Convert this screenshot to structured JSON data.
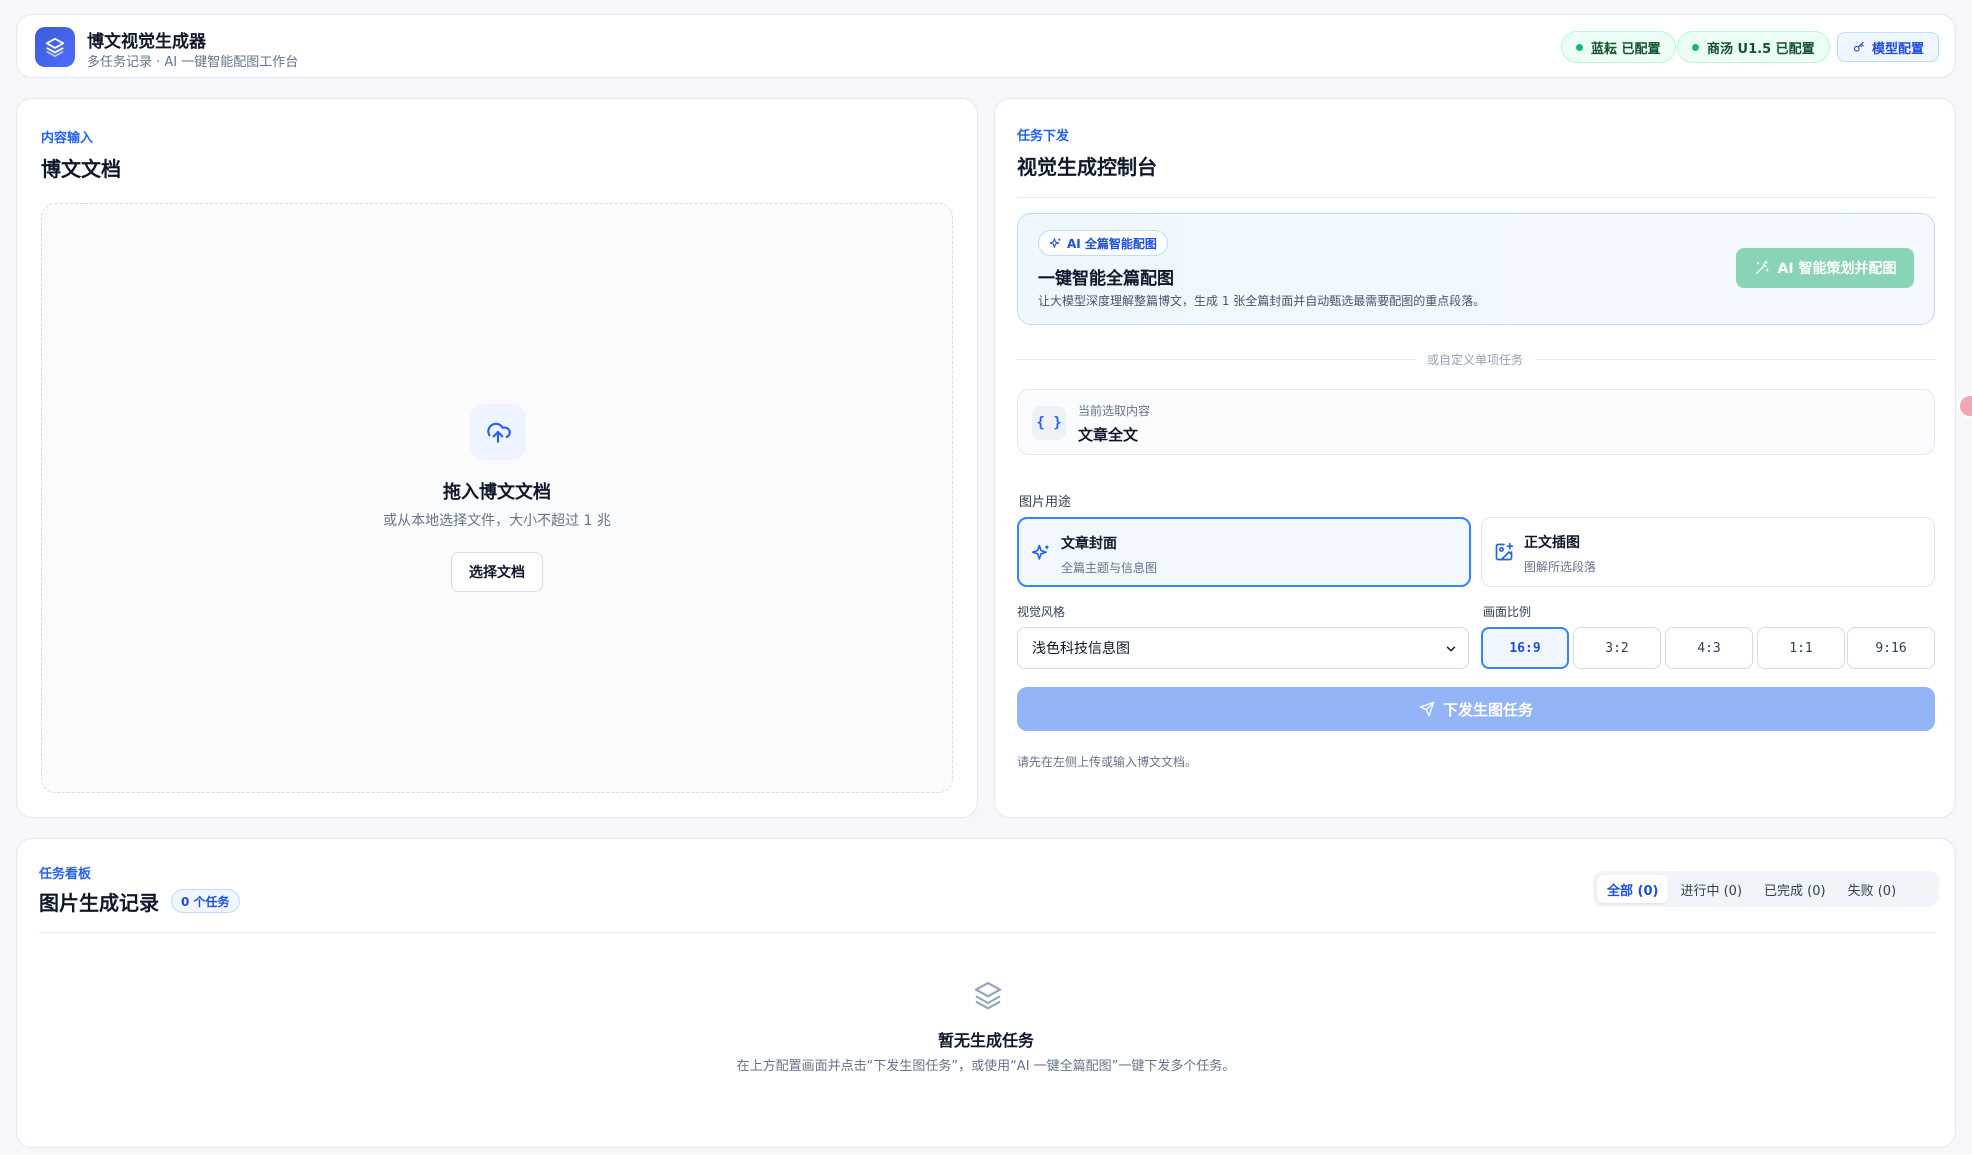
{
  "header": {
    "title": "博文视觉生成器",
    "subtitle": "多任务记录 · AI 一键智能配图工作台",
    "status_lanyun": "蓝耘 已配置",
    "status_shangtang": "商汤 U1.5 已配置",
    "model_config": "模型配置"
  },
  "input_panel": {
    "eyebrow": "内容输入",
    "title": "博文文档",
    "drop_title": "拖入博文文档",
    "drop_sub": "或从本地选择文件，大小不超过 1 兆",
    "choose_btn": "选择文档"
  },
  "control_panel": {
    "eyebrow": "任务下发",
    "title": "视觉生成控制台",
    "ai": {
      "badge": "AI 全篇智能配图",
      "title": "一键智能全篇配图",
      "desc": "让大模型深度理解整篇博文，生成 1 张全篇封面并自动甄选最需要配图的重点段落。",
      "button": "AI 智能策划并配图"
    },
    "or_text": "或自定义单项任务",
    "selection": {
      "label": "当前选取内容",
      "value": "文章全文"
    },
    "usage_label": "图片用途",
    "usages": [
      {
        "title": "文章封面",
        "desc": "全篇主题与信息图"
      },
      {
        "title": "正文插图",
        "desc": "图解所选段落"
      }
    ],
    "style_label": "视觉风格",
    "style_value": "浅色科技信息图",
    "ratio_label": "画面比例",
    "ratios": [
      "16:9",
      "3:2",
      "4:3",
      "1:1",
      "9:16"
    ],
    "selected_ratio": "16:9",
    "submit": "下发生图任务",
    "hint": "请先在左侧上传或输入博文文档。"
  },
  "task_board": {
    "eyebrow": "任务看板",
    "title": "图片生成记录",
    "count": "0 个任务",
    "filters": [
      "全部 (0)",
      "进行中 (0)",
      "已完成 (0)",
      "失败 (0)"
    ],
    "empty_title": "暂无生成任务",
    "empty_desc": "在上方配置画面并点击“下发生图任务”，或使用“AI 一键全篇配图”一键下发多个任务。"
  },
  "colors": {
    "accent": "#2563eb",
    "success": "#10b981",
    "ai_button": "#88d4b5",
    "submit_disabled": "#93b4f7"
  },
  "icons": [
    "layers-icon",
    "dot-icon",
    "key-icon",
    "upload-cloud-icon",
    "sparkles-icon",
    "wand-icon",
    "braces-icon",
    "image-plus-icon",
    "chevron-down-icon",
    "send-icon"
  ]
}
